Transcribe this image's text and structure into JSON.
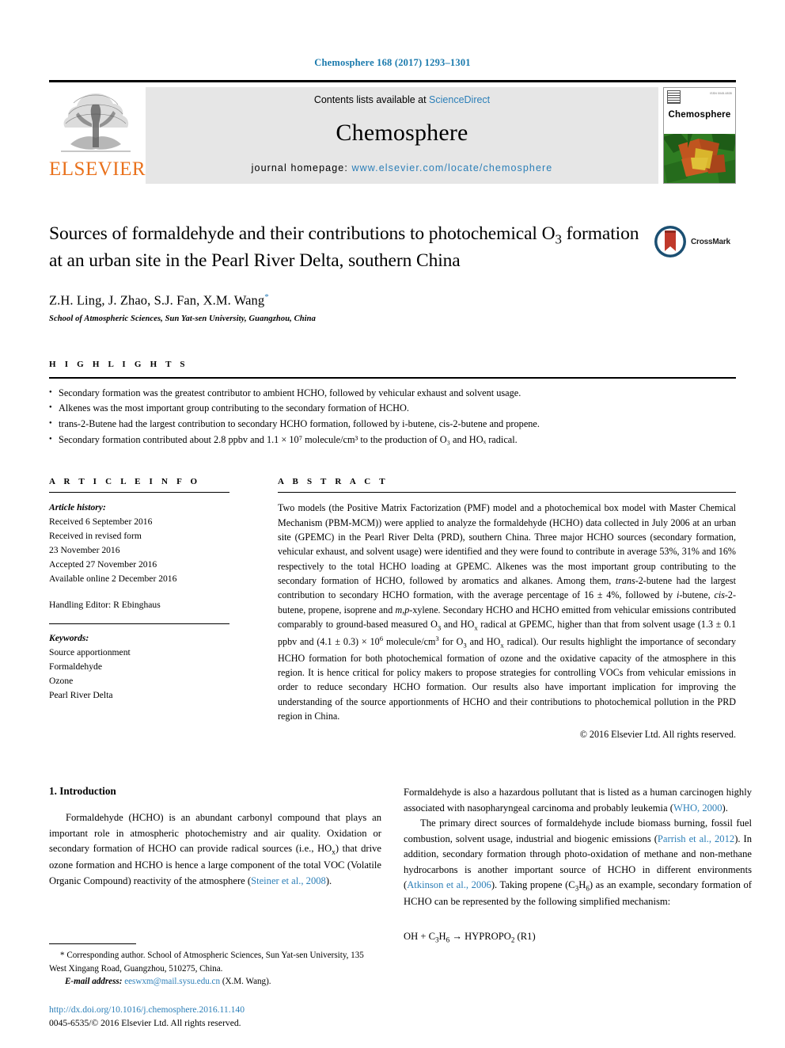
{
  "running_head": "Chemosphere 168 (2017) 1293–1301",
  "masthead": {
    "publisher": "ELSEVIER",
    "contents_prefix": "Contents lists available at ",
    "contents_link": "ScienceDirect",
    "journal_title": "Chemosphere",
    "homepage_label": "journal homepage: ",
    "homepage_url": "www.elsevier.com/locate/chemosphere",
    "cover_journal_name": "Chemosphere",
    "cover_issn": "ISSN 0045-6535"
  },
  "article": {
    "title_line1": "Sources of formaldehyde and their contributions to photochemical O",
    "title_sub1": "3",
    "title_line2": "formation at an urban site in the Pearl River Delta, southern China",
    "authors": "Z.H. Ling, J. Zhao, S.J. Fan, X.M. Wang",
    "author_star": "*",
    "affiliation": "School of Atmospheric Sciences, Sun Yat-sen University, Guangzhou, China",
    "crossmark_label": "CrossMark"
  },
  "highlights": {
    "heading": "H I G H L I G H T S",
    "items": [
      "Secondary formation was the greatest contributor to ambient HCHO, followed by vehicular exhaust and solvent usage.",
      "Alkenes was the most important group contributing to the secondary formation of HCHO.",
      "trans-2-Butene had the largest contribution to secondary HCHO formation, followed by i-butene, cis-2-butene and propene.",
      "Secondary formation contributed about 2.8 ppbv and 1.1 × 10⁷ molecule/cm³ to the production of O₃ and HOₓ radical."
    ]
  },
  "article_info": {
    "heading": "A R T I C L E  I N F O",
    "history_label": "Article history:",
    "history": [
      "Received 6 September 2016",
      "Received in revised form",
      "23 November 2016",
      "Accepted 27 November 2016",
      "Available online 2 December 2016"
    ],
    "handling_editor": "Handling Editor: R Ebinghaus",
    "keywords_label": "Keywords:",
    "keywords": [
      "Source apportionment",
      "Formaldehyde",
      "Ozone",
      "Pearl River Delta"
    ]
  },
  "abstract": {
    "heading": "A B S T R A C T",
    "text": "Two models (the Positive Matrix Factorization (PMF) model and a photochemical box model with Master Chemical Mechanism (PBM-MCM)) were applied to analyze the formaldehyde (HCHO) data collected in July 2006 at an urban site (GPEMC) in the Pearl River Delta (PRD), southern China. Three major HCHO sources (secondary formation, vehicular exhaust, and solvent usage) were identified and they were found to contribute in average 53%, 31% and 16% respectively to the total HCHO loading at GPEMC. Alkenes was the most important group contributing to the secondary formation of HCHO, followed by aromatics and alkanes. Among them, trans-2-butene had the largest contribution to secondary HCHO formation, with the average percentage of 16 ± 4%, followed by i-butene, cis-2-butene, propene, isoprene and m,p-xylene. Secondary HCHO and HCHO emitted from vehicular emissions contributed comparably to ground-based measured O3 and HOx radical at GPEMC, higher than that from solvent usage (1.3 ± 0.1 ppbv and (4.1 ± 0.3) × 106 molecule/cm3 for O3 and HOx radical). Our results highlight the importance of secondary HCHO formation for both photochemical formation of ozone and the oxidative capacity of the atmosphere in this region. It is hence critical for policy makers to propose strategies for controlling VOCs from vehicular emissions in order to reduce secondary HCHO formation. Our results also have important implication for improving the understanding of the source apportionments of HCHO and their contributions to photochemical pollution in the PRD region in China.",
    "copyright": "© 2016 Elsevier Ltd. All rights reserved."
  },
  "introduction": {
    "heading": "1. Introduction",
    "para1": "Formaldehyde (HCHO) is an abundant carbonyl compound that plays an important role in atmospheric photochemistry and air quality. Oxidation or secondary formation of HCHO can provide radical sources (i.e., HOx) that drive ozone formation and HCHO is hence a large component of the total VOC (Volatile Organic Compound) reactivity of the atmosphere (Steiner et al., 2008).",
    "ref_steiner": "Steiner et al., 2008",
    "para2": "Formaldehyde is also a hazardous pollutant that is listed as a human carcinogen highly associated with nasopharyngeal carcinoma and probably leukemia (WHO, 2000).",
    "ref_who": "WHO, 2000",
    "para3": "The primary direct sources of formaldehyde include biomass burning, fossil fuel combustion, solvent usage, industrial and biogenic emissions (Parrish et al., 2012). In addition, secondary formation through photo-oxidation of methane and non-methane hydrocarbons is another important source of HCHO in different environments (Atkinson et al., 2006). Taking propene (C3H6) as an example, secondary formation of HCHO can be represented by the following simplified mechanism:",
    "ref_parrish": "Parrish et al., 2012",
    "ref_atkinson": "Atkinson et al., 2006",
    "reaction": "OH + C3H6 → HYPROPO2 (R1)",
    "reaction_label": "(R1)"
  },
  "footnotes": {
    "corresponding": "* Corresponding author. School of Atmospheric Sciences, Sun Yat-sen University, 135 West Xingang Road, Guangzhou, 510275, China.",
    "email_label": "E-mail address:",
    "email": "eeswxm@mail.sysu.edu.cn",
    "email_suffix": "(X.M. Wang).",
    "doi": "http://dx.doi.org/10.1016/j.chemosphere.2016.11.140",
    "issn_line": "0045-6535/© 2016 Elsevier Ltd. All rights reserved."
  },
  "colors": {
    "link_blue": "#2c7fb8",
    "running_head_blue": "#1a7aad",
    "elsevier_orange": "#E9711C",
    "banner_grey": "#e6e6e6"
  }
}
